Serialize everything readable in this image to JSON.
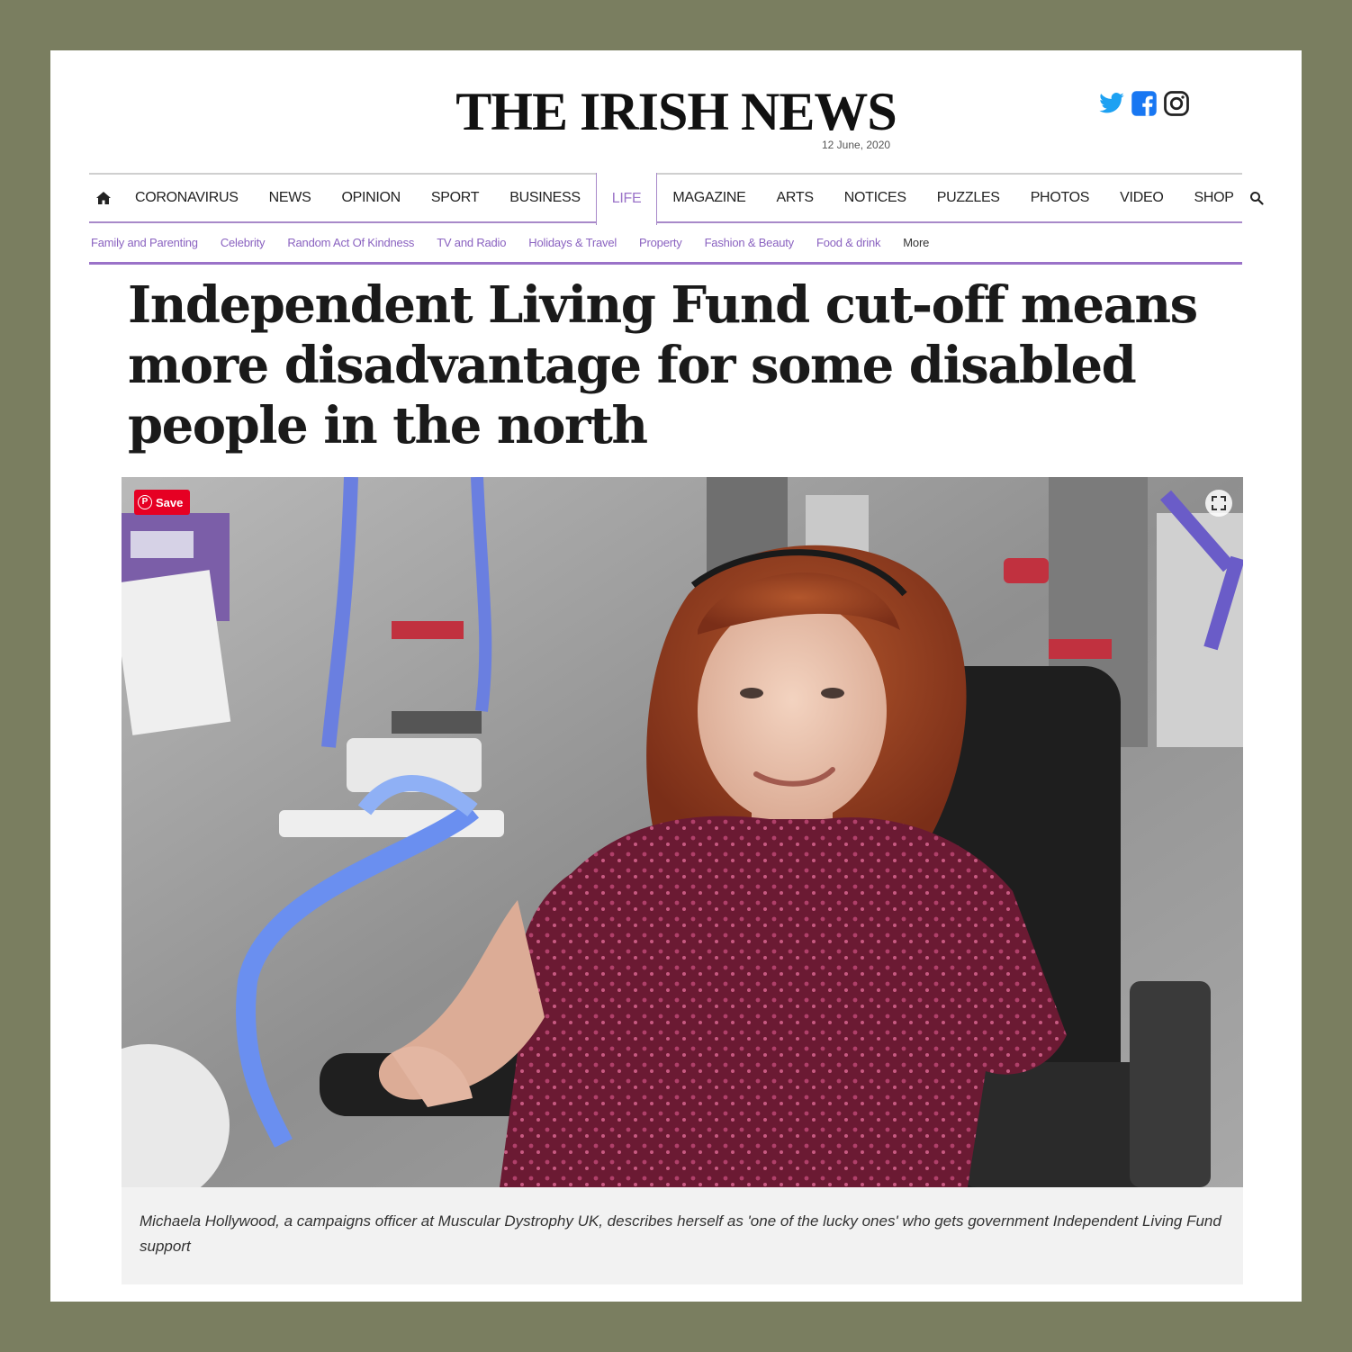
{
  "masthead": {
    "title": "THE IRISH NEWS",
    "date": "12 June, 2020",
    "social": [
      "twitter-icon",
      "facebook-icon",
      "instagram-icon"
    ]
  },
  "nav": {
    "items": [
      "CORONAVIRUS",
      "NEWS",
      "OPINION",
      "SPORT",
      "BUSINESS",
      "LIFE",
      "MAGAZINE",
      "ARTS",
      "NOTICES",
      "PUZZLES",
      "PHOTOS",
      "VIDEO",
      "SHOP"
    ],
    "active": "LIFE"
  },
  "subnav": {
    "items": [
      "Family and Parenting",
      "Celebrity",
      "Random Act Of Kindness",
      "TV and Radio",
      "Holidays & Travel",
      "Property",
      "Fashion & Beauty",
      "Food & drink"
    ],
    "more_label": "More"
  },
  "article": {
    "headline": "Independent Living Fund cut-off means more disadvantage for some disabled people in the north",
    "save_label": "Save",
    "caption": "Michaela Hollywood, a campaigns officer at Muscular Dystrophy UK, describes herself as 'one of the lucky ones' who gets government Independent Living Fund support"
  },
  "colors": {
    "frame": "#7a7e60",
    "accent": "#9a72c8",
    "twitter": "#1da1f2",
    "facebook": "#1877f2",
    "pinterest": "#e60023"
  }
}
